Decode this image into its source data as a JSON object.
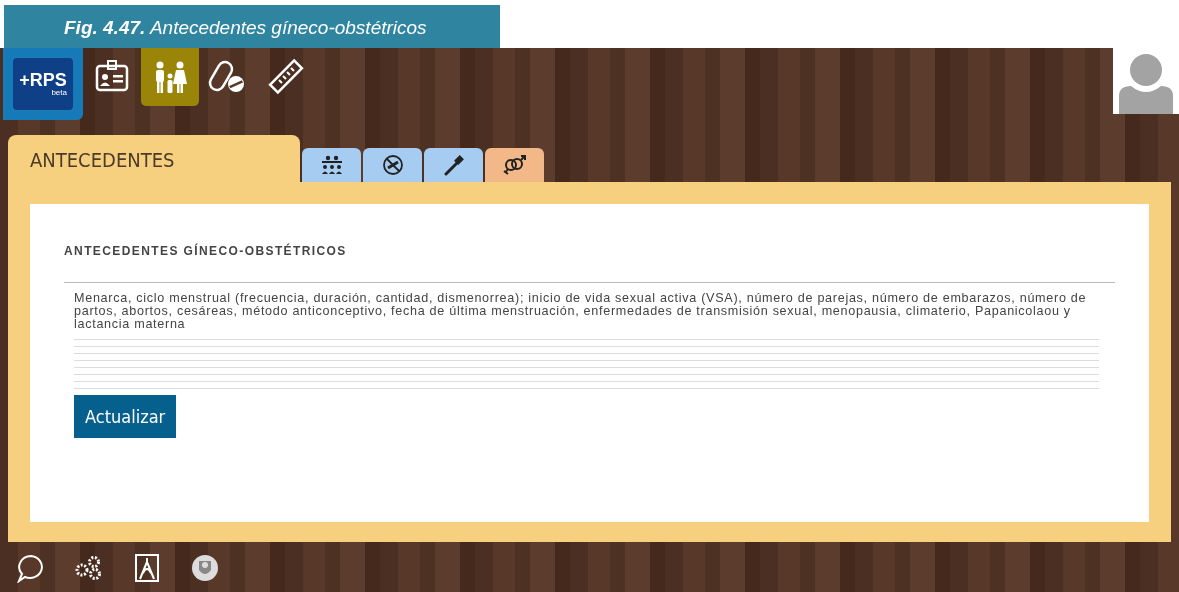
{
  "caption": "**Fig. 4.47.** Antecedentes gíneco-obstétricos",
  "logo": {
    "text": "+RPS",
    "subtext": "beta"
  },
  "toolbar": [
    {
      "kind": "id-card",
      "selected": false
    },
    {
      "kind": "family",
      "selected": true
    },
    {
      "kind": "pills",
      "selected": false
    },
    {
      "kind": "ruler",
      "selected": false
    }
  ],
  "section_tab": "ANTECEDENTES",
  "subtabs": [
    {
      "kind": "people",
      "selected": false
    },
    {
      "kind": "no-smoking",
      "selected": false
    },
    {
      "kind": "toothbrush",
      "selected": false
    },
    {
      "kind": "gender",
      "selected": true
    }
  ],
  "form": {
    "heading": "ANTECEDENTES GÍNECO-OBSTÉTRICOS",
    "value": "Menarca, ciclo menstrual (frecuencia, duración, cantidad, dismenorrea); inicio de vida sexual activa (VSA), número de parejas, número de embarazos, número de partos, abortos, cesáreas, método anticonceptivo, fecha de última menstruación, enfermedades de transmisión sexual, menopausia, climaterio, Papanicolaou y lactancia materna",
    "button": "Actualizar"
  },
  "bottom_bar": [
    {
      "kind": "chat"
    },
    {
      "kind": "gears"
    },
    {
      "kind": "document"
    },
    {
      "kind": "emblem"
    }
  ]
}
